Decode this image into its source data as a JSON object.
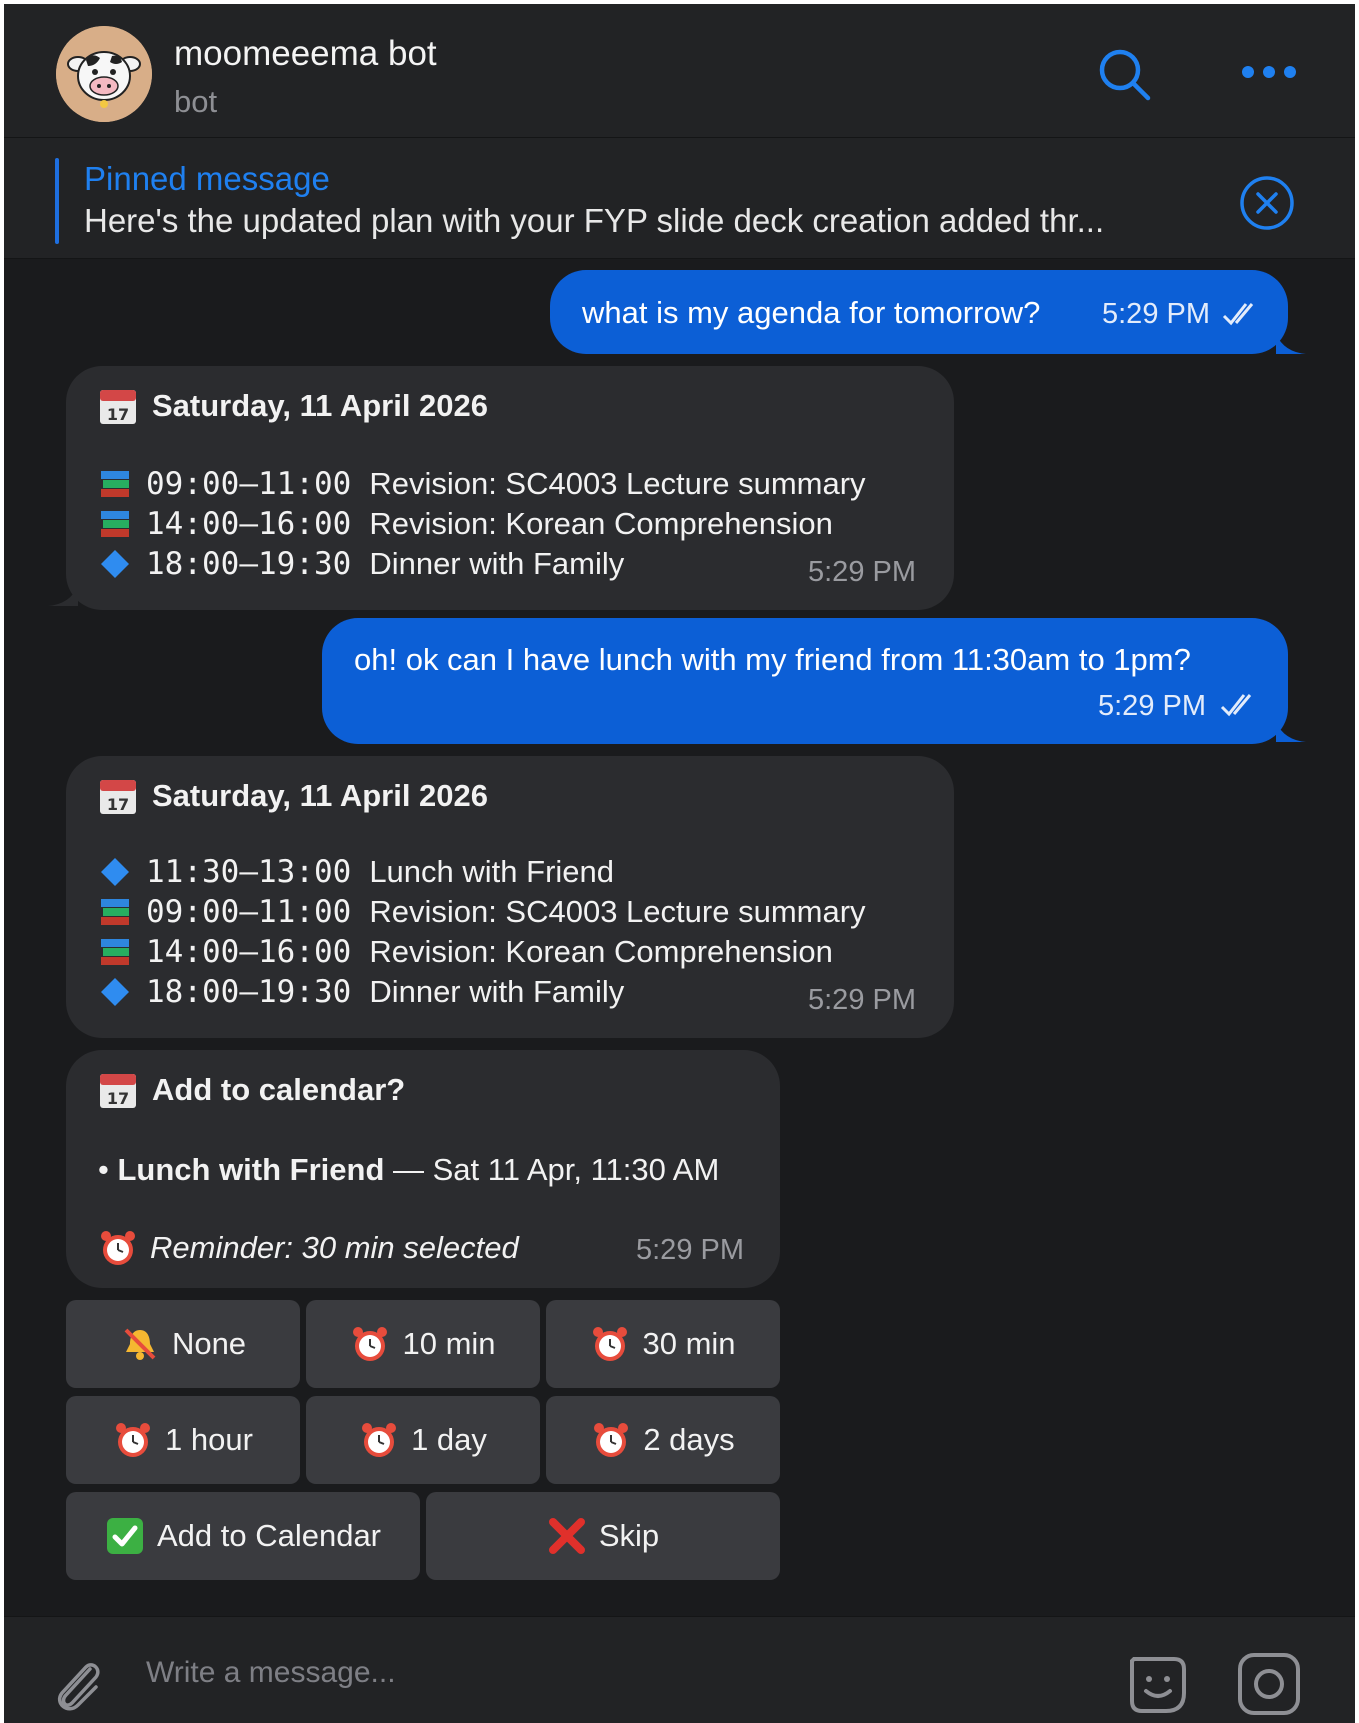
{
  "header": {
    "title": "moomeeema bot",
    "subtitle": "bot"
  },
  "pinned": {
    "title": "Pinned message",
    "text": "Here's the updated plan with your FYP slide deck creation added thr..."
  },
  "messages": [
    {
      "type": "outgoing",
      "text": "what is my agenda for tomorrow?",
      "time": "5:29 PM"
    },
    {
      "type": "incoming",
      "header": "Saturday, 11 April 2026",
      "items": [
        {
          "icon": "books-icon",
          "time": "09:00–11:00",
          "label": "Revision: SC4003 Lecture summary"
        },
        {
          "icon": "books-icon",
          "time": "14:00–16:00",
          "label": "Revision: Korean Comprehension"
        },
        {
          "icon": "blue-diamond-icon",
          "time": "18:00–19:30",
          "label": "Dinner with Family"
        }
      ],
      "time": "5:29 PM"
    },
    {
      "type": "outgoing",
      "text": "oh! ok can I have lunch with my friend from 11:30am to 1pm?",
      "time": "5:29 PM"
    },
    {
      "type": "incoming",
      "header": "Saturday, 11 April 2026",
      "items": [
        {
          "icon": "blue-diamond-icon",
          "time": "11:30–13:00",
          "label": "Lunch with Friend"
        },
        {
          "icon": "books-icon",
          "time": "09:00–11:00",
          "label": "Revision: SC4003 Lecture summary"
        },
        {
          "icon": "books-icon",
          "time": "14:00–16:00",
          "label": "Revision: Korean Comprehension"
        },
        {
          "icon": "blue-diamond-icon",
          "time": "18:00–19:30",
          "label": "Dinner with Family"
        }
      ],
      "time": "5:29 PM"
    },
    {
      "type": "incoming",
      "header": "Add to calendar?",
      "event_bold": "Lunch with Friend",
      "event_rest": " — Sat 11 Apr, 11:30 AM",
      "reminder": "Reminder: 30 min selected",
      "time": "5:29 PM"
    }
  ],
  "keyboard": {
    "row1": [
      {
        "label": "None",
        "icon": "bell-off-icon"
      },
      {
        "label": "10 min",
        "icon": "alarm-clock-icon"
      },
      {
        "label": "30 min",
        "icon": "alarm-clock-icon"
      }
    ],
    "row2": [
      {
        "label": "1 hour",
        "icon": "alarm-clock-icon"
      },
      {
        "label": "1 day",
        "icon": "alarm-clock-icon"
      },
      {
        "label": "2 days",
        "icon": "alarm-clock-icon"
      }
    ],
    "row3": [
      {
        "label": "Add to Calendar",
        "icon": "check-box-icon"
      },
      {
        "label": "Skip",
        "icon": "cross-mark-icon"
      }
    ]
  },
  "composer": {
    "placeholder": "Write a message..."
  },
  "colors": {
    "accent": "#1f80f0",
    "outgoing_bubble": "#0c5fd6",
    "incoming_bubble": "#2b2c2f",
    "background": "#1a1b1d"
  }
}
